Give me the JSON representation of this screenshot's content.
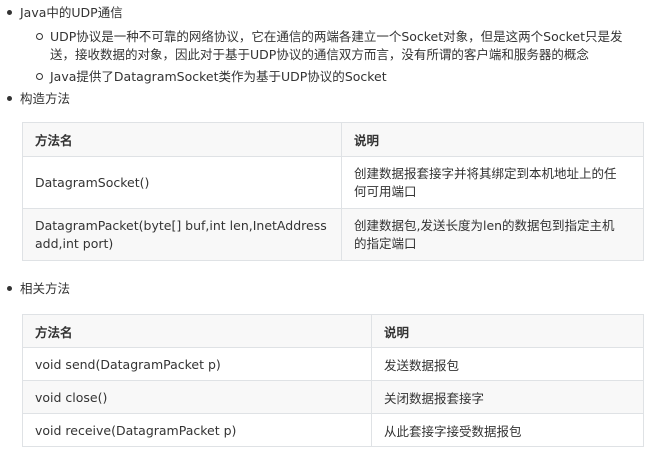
{
  "udp_section": {
    "bullet": "Java中的UDP通信",
    "sub1_line1": "UDP协议是一种不可靠的网络协议，它在通信的两端各建立一个Socket对象，但是这两个Socket只是发",
    "sub1_line2": "送，接收数据的对象，因此对于基于UDP协议的通信双方而言，没有所谓的客户端和服务器的概念",
    "sub2": "Java提供了DatagramSocket类作为基于UDP协议的Socket"
  },
  "constructor_section": {
    "bullet": "构造方法",
    "headers": [
      "方法名",
      "说明"
    ],
    "rows": [
      {
        "method": "DatagramSocket()",
        "desc_l1": "创建数据报套接字并将其绑定到本机地址上的任",
        "desc_l2": "何可用端口"
      },
      {
        "method_l1": "DatagramPacket(byte[] buf,int len,InetAddress",
        "method_l2": "add,int port)",
        "desc_l1": "创建数据包,发送长度为len的数据包到指定主机",
        "desc_l2": "的指定端口"
      }
    ]
  },
  "methods_section": {
    "bullet": "相关方法",
    "headers": [
      "方法名",
      "说明"
    ],
    "rows": [
      {
        "method": "void send(DatagramPacket p)",
        "desc": "发送数据报包"
      },
      {
        "method": "void close()",
        "desc": "关闭数据报套接字"
      },
      {
        "method": "void receive(DatagramPacket p)",
        "desc": "从此套接字接受数据报包"
      }
    ]
  }
}
